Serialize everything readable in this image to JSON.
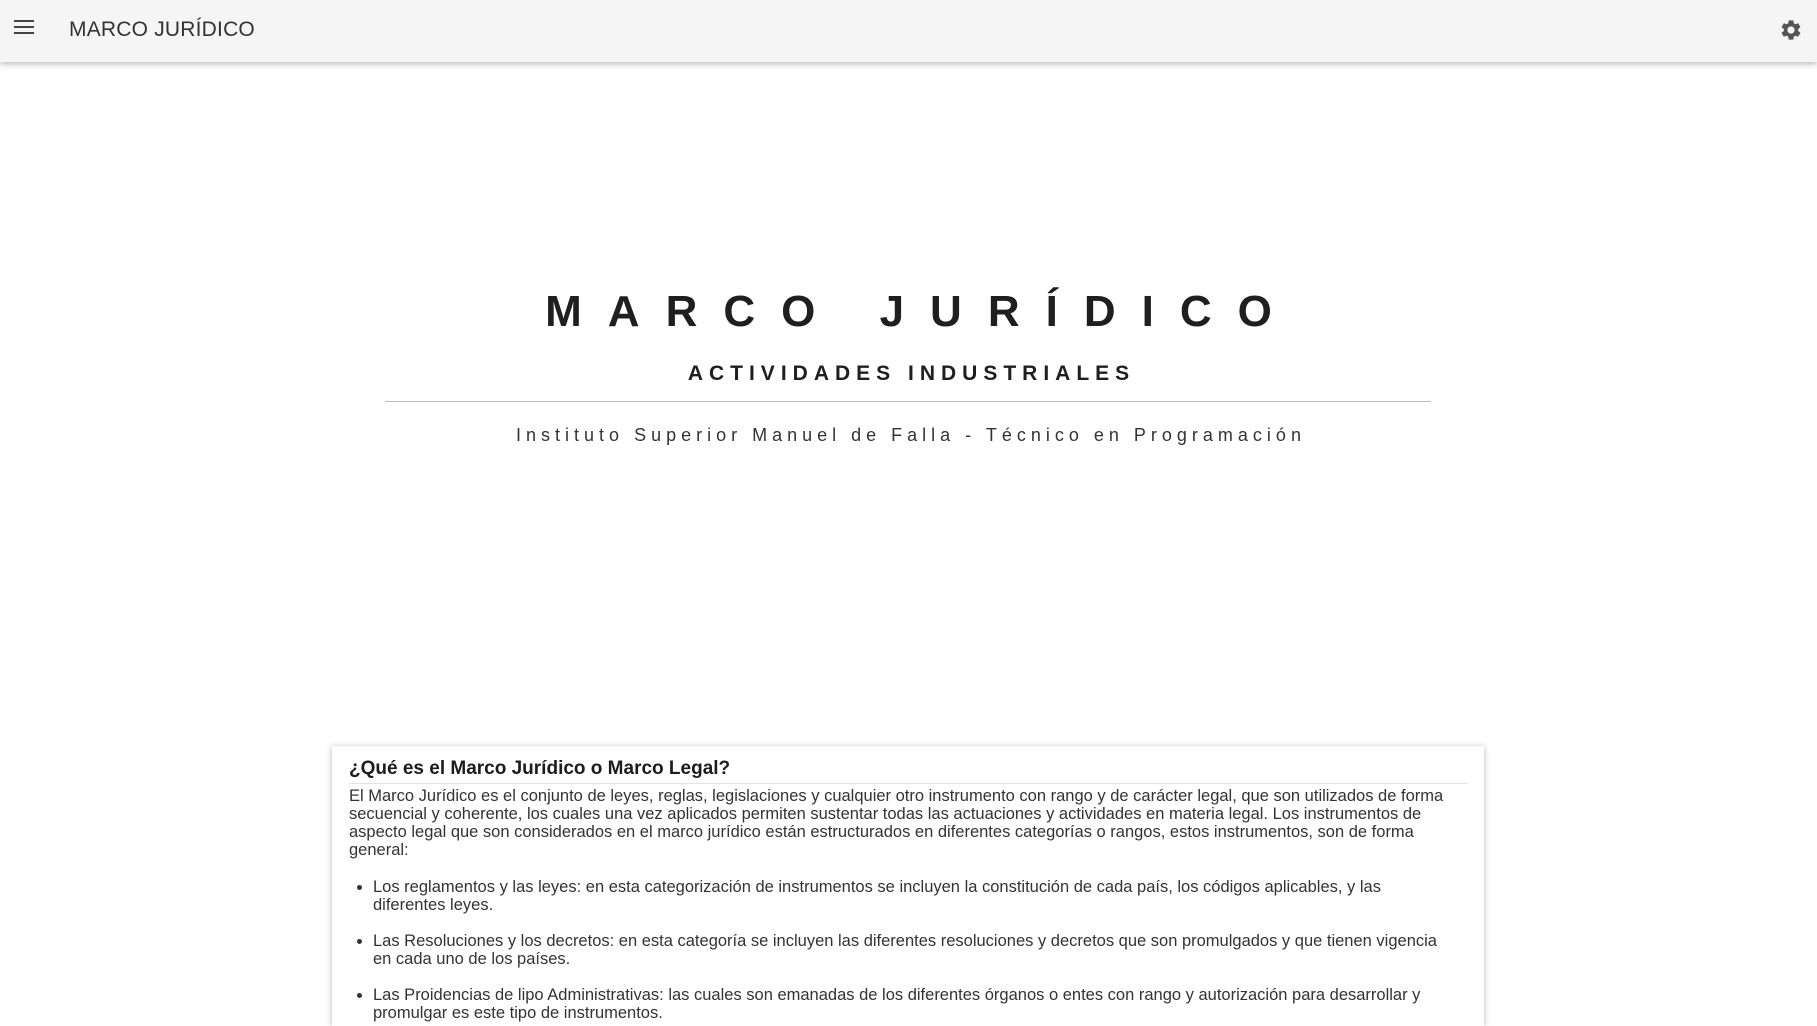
{
  "toolbar": {
    "menu_icon": "menu-icon",
    "title": "MARCO JURÍDICO",
    "settings_icon": "gear-icon"
  },
  "hero": {
    "title": "MARCO JURÍDICO",
    "subtitle": "ACTIVIDADES INDUSTRIALES",
    "institute": "Instituto Superior Manuel de Falla - Técnico en Programación"
  },
  "card": {
    "title": "¿Qué es el Marco Jurídico o Marco Legal?",
    "paragraph": "El Marco Jurídico es el conjunto de leyes, reglas, legislaciones y cualquier otro instrumento con rango y de carácter legal, que son utilizados de forma secuencial y coherente, los cuales una vez aplicados permiten sustentar todas las actuaciones y actividades en materia legal. Los instrumentos de aspecto legal que son considerados en el marco jurídico están estructurados en diferentes categorías o rangos, estos instrumentos, son de forma general:",
    "items": [
      "Los reglamentos y las leyes: en esta categorización de instrumentos se incluyen la constitución de cada país, los códigos aplicables, y las diferentes leyes.",
      "Las Resoluciones y los decretos: en esta categoría se incluyen las diferentes resoluciones y decretos que son promulgados y que tienen vigencia en cada uno de los países.",
      "Las Proidencias de lipo Administrativas: las cuales son emanadas de los diferentes órganos o entes con rango y autorización para desarrollar y promulgar es este tipo de instrumentos."
    ]
  },
  "colors": {
    "toolbar_bg": "#f5f5f5",
    "page_bg": "#ffffff",
    "text": "#222222"
  }
}
